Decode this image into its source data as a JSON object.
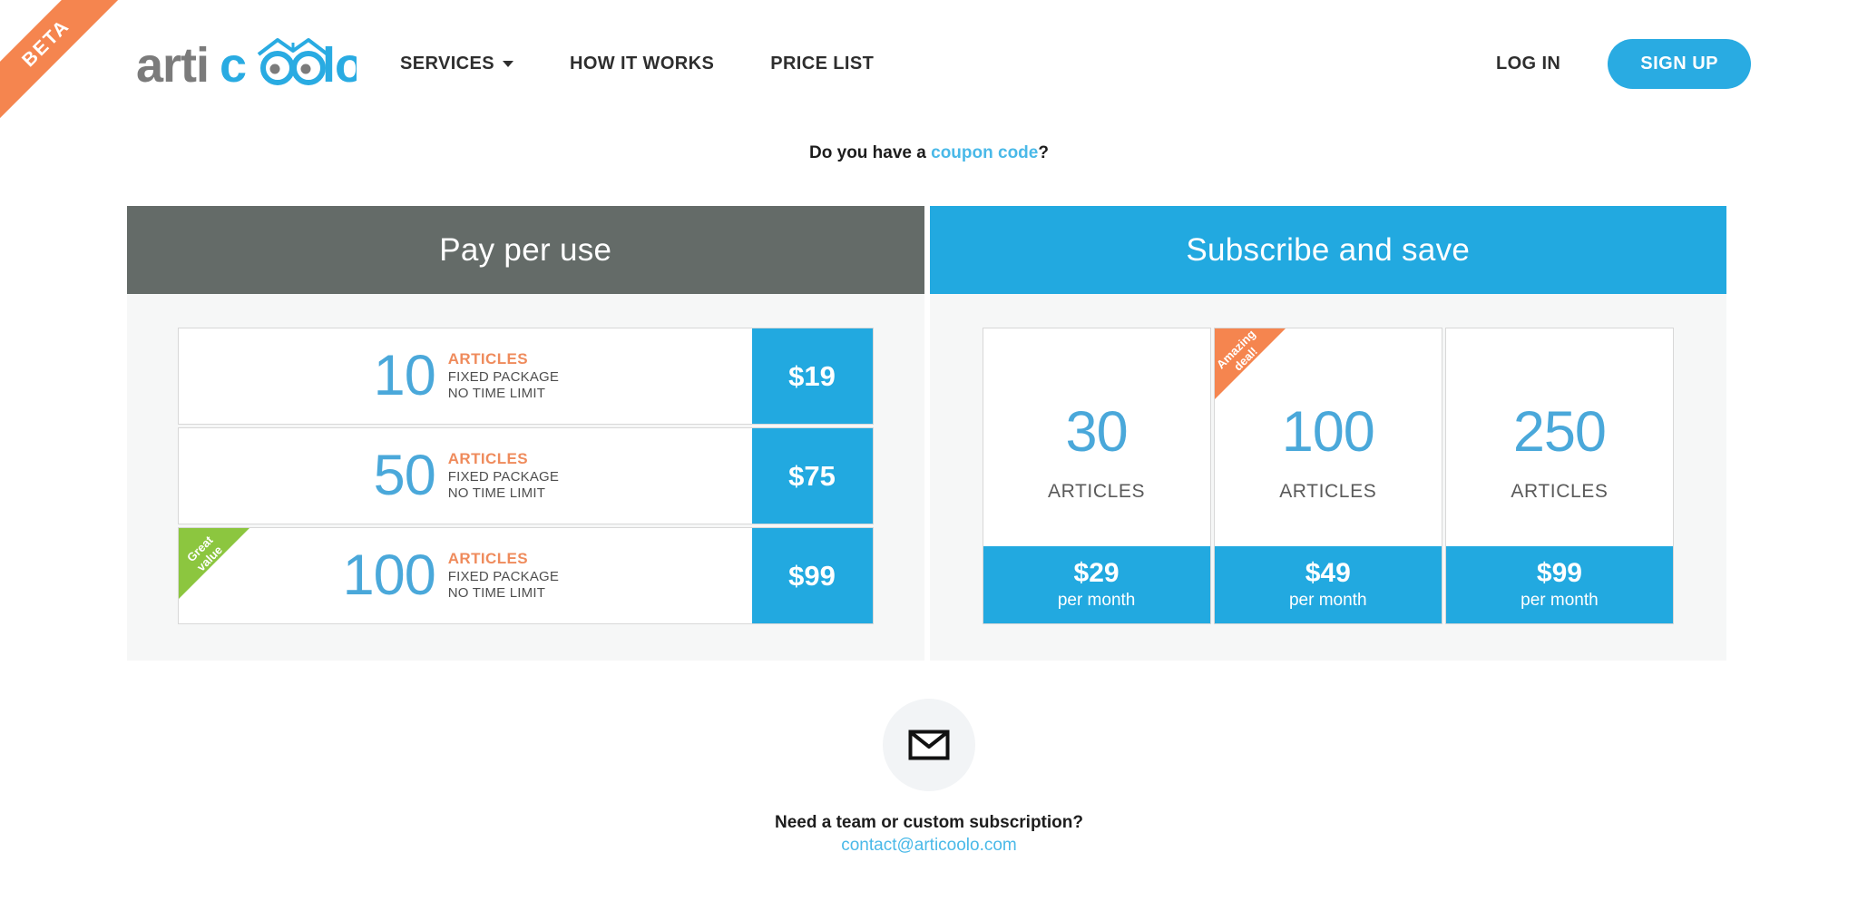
{
  "ribbon": {
    "label": "BETA",
    "color": "#f5854f"
  },
  "header": {
    "logo_text": "articoolo",
    "nav": [
      {
        "label": "SERVICES",
        "has_caret": true,
        "icon": "chevron-down-icon"
      },
      {
        "label": "HOW IT WORKS",
        "has_caret": false
      },
      {
        "label": "PRICE LIST",
        "has_caret": false
      }
    ],
    "login_label": "LOG IN",
    "signup_label": "SIGN UP",
    "accent_color": "#29abe2"
  },
  "coupon": {
    "prefix": "Do you have a ",
    "link": "coupon code",
    "suffix": "?"
  },
  "pay_per_use": {
    "title": "Pay per use",
    "header_color": "#646b68",
    "rows": [
      {
        "qty": "10",
        "articles": "ARTICLES",
        "line1": "FIXED PACKAGE",
        "line2": "NO TIME LIMIT",
        "price": "$19",
        "badge": null
      },
      {
        "qty": "50",
        "articles": "ARTICLES",
        "line1": "FIXED PACKAGE",
        "line2": "NO TIME LIMIT",
        "price": "$75",
        "badge": null
      },
      {
        "qty": "100",
        "articles": "ARTICLES",
        "line1": "FIXED PACKAGE",
        "line2": "NO TIME LIMIT",
        "price": "$99",
        "badge": {
          "line1": "Great",
          "line2": "value",
          "color": "#8cc63f"
        }
      }
    ]
  },
  "subscribe": {
    "title": "Subscribe and save",
    "header_color": "#22a9e0",
    "cards": [
      {
        "qty": "30",
        "articles": "ARTICLES",
        "price": "$29",
        "period": "per month",
        "badge": null
      },
      {
        "qty": "100",
        "articles": "ARTICLES",
        "price": "$49",
        "period": "per month",
        "badge": {
          "line1": "Amazing",
          "line2": "deal!",
          "color": "#f5854f"
        }
      },
      {
        "qty": "250",
        "articles": "ARTICLES",
        "price": "$99",
        "period": "per month",
        "badge": null
      }
    ]
  },
  "contact": {
    "icon": "envelope-icon",
    "heading": "Need a team or custom subscription?",
    "email": "contact@articoolo.com"
  }
}
